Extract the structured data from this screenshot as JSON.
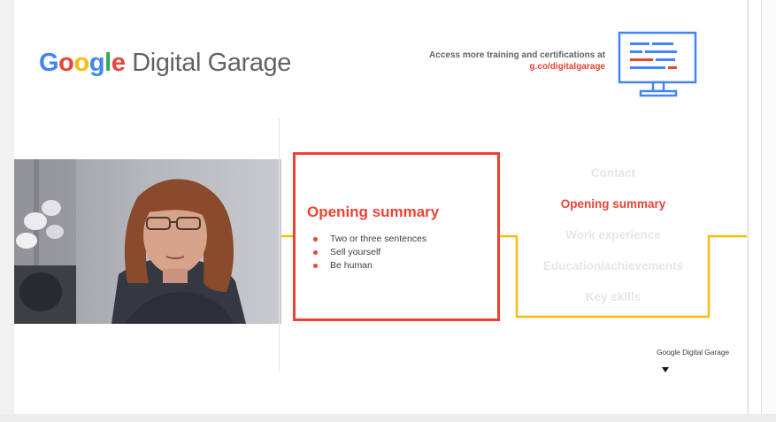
{
  "slide": {
    "logo": {
      "brand_letters": [
        {
          "char": "G",
          "color": "#4285f4"
        },
        {
          "char": "o",
          "color": "#ea4335"
        },
        {
          "char": "o",
          "color": "#fbbc05"
        },
        {
          "char": "g",
          "color": "#4285f4"
        },
        {
          "char": "l",
          "color": "#34a853"
        },
        {
          "char": "e",
          "color": "#ea4335"
        }
      ],
      "product": " Digital Garage"
    },
    "promo": {
      "line1": "Access more training and certifications at",
      "line2": "g.co/digitalgarage"
    },
    "monitor_icon": "monitor-icon",
    "card": {
      "title": "Opening summary",
      "bullets": [
        "Two or three sentences",
        "Sell yourself",
        "Be human"
      ]
    },
    "sections": [
      {
        "label": "Contact",
        "active": false
      },
      {
        "label": "Opening summary",
        "active": true
      },
      {
        "label": "Work experience",
        "active": false
      },
      {
        "label": "Education/achievements",
        "active": false
      },
      {
        "label": "Key skills",
        "active": false
      }
    ],
    "footer_logo": "Google Digital Garage",
    "colors": {
      "red": "#ea4335",
      "yellow": "#fbbc05",
      "blue": "#4285f4",
      "green": "#34a853",
      "grey_text": "#5f6368"
    }
  },
  "webcam": {
    "kind": "webcam-video-feed"
  }
}
